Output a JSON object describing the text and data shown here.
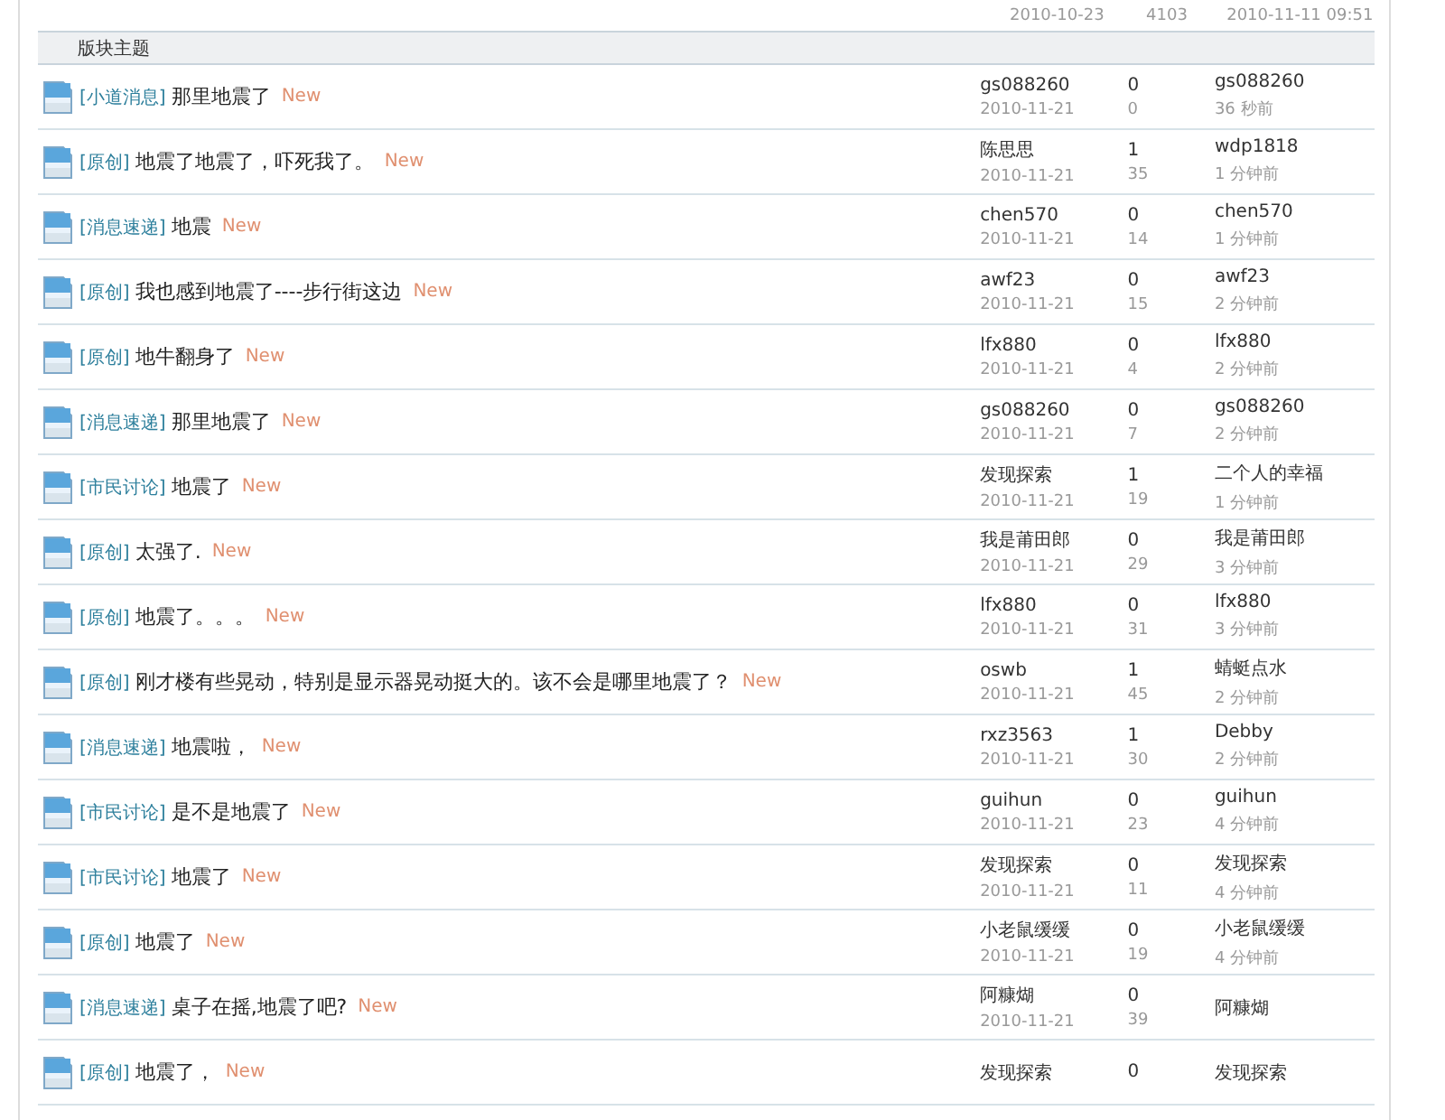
{
  "top_row": {
    "date": "2010-10-23",
    "views": "4103",
    "last_time": "2010-11-11 09:51"
  },
  "section_header": "版块主题",
  "threads": [
    {
      "tag": "[小道消息]",
      "title": "那里地震了",
      "new": "New",
      "author": "gs088260",
      "date": "2010-11-21",
      "replies": "0",
      "views": "0",
      "last_poster": "gs088260",
      "last_time": "36 秒前"
    },
    {
      "tag": "[原创]",
      "title": "地震了地震了，吓死我了。",
      "new": "New",
      "author": "陈思思",
      "date": "2010-11-21",
      "replies": "1",
      "views": "35",
      "last_poster": "wdp1818",
      "last_time": "1 分钟前"
    },
    {
      "tag": "[消息速递]",
      "title": "地震",
      "new": "New",
      "author": "chen570",
      "date": "2010-11-21",
      "replies": "0",
      "views": "14",
      "last_poster": "chen570",
      "last_time": "1 分钟前"
    },
    {
      "tag": "[原创]",
      "title": "我也感到地震了----步行街这边",
      "new": "New",
      "author": "awf23",
      "date": "2010-11-21",
      "replies": "0",
      "views": "15",
      "last_poster": "awf23",
      "last_time": "2 分钟前"
    },
    {
      "tag": "[原创]",
      "title": "地牛翻身了",
      "new": "New",
      "author": "lfx880",
      "date": "2010-11-21",
      "replies": "0",
      "views": "4",
      "last_poster": "lfx880",
      "last_time": "2 分钟前"
    },
    {
      "tag": "[消息速递]",
      "title": "那里地震了",
      "new": "New",
      "author": "gs088260",
      "date": "2010-11-21",
      "replies": "0",
      "views": "7",
      "last_poster": "gs088260",
      "last_time": "2 分钟前"
    },
    {
      "tag": "[市民讨论]",
      "title": "地震了",
      "new": "New",
      "author": "发现探索",
      "date": "2010-11-21",
      "replies": "1",
      "views": "19",
      "last_poster": "二个人的幸福",
      "last_time": "1 分钟前"
    },
    {
      "tag": "[原创]",
      "title": "太强了.",
      "new": "New",
      "author": "我是莆田郎",
      "date": "2010-11-21",
      "replies": "0",
      "views": "29",
      "last_poster": "我是莆田郎",
      "last_time": "3 分钟前"
    },
    {
      "tag": "[原创]",
      "title": "地震了。。。",
      "new": "New",
      "author": "lfx880",
      "date": "2010-11-21",
      "replies": "0",
      "views": "31",
      "last_poster": "lfx880",
      "last_time": "3 分钟前"
    },
    {
      "tag": "[原创]",
      "title": "刚才楼有些晃动，特别是显示器晃动挺大的。该不会是哪里地震了？",
      "new": "New",
      "author": "oswb",
      "date": "2010-11-21",
      "replies": "1",
      "views": "45",
      "last_poster": "蜻蜓点水",
      "last_time": "2 分钟前"
    },
    {
      "tag": "[消息速递]",
      "title": "地震啦，",
      "new": "New",
      "author": "rxz3563",
      "date": "2010-11-21",
      "replies": "1",
      "views": "30",
      "last_poster": "Debby",
      "last_time": "2 分钟前"
    },
    {
      "tag": "[市民讨论]",
      "title": "是不是地震了",
      "new": "New",
      "author": "guihun",
      "date": "2010-11-21",
      "replies": "0",
      "views": "23",
      "last_poster": "guihun",
      "last_time": "4 分钟前"
    },
    {
      "tag": "[市民讨论]",
      "title": "地震了",
      "new": "New",
      "author": "发现探索",
      "date": "2010-11-21",
      "replies": "0",
      "views": "11",
      "last_poster": "发现探索",
      "last_time": "4 分钟前"
    },
    {
      "tag": "[原创]",
      "title": "地震了",
      "new": "New",
      "author": "小老鼠缓缓",
      "date": "2010-11-21",
      "replies": "0",
      "views": "19",
      "last_poster": "小老鼠缓缓",
      "last_time": "4 分钟前"
    },
    {
      "tag": "[消息速递]",
      "title": "桌子在摇,地震了吧?",
      "new": "New",
      "author": "阿糠煳",
      "date": "2010-11-21",
      "replies": "0",
      "views": "39",
      "last_poster": "阿糠煳"
    },
    {
      "tag": "[原创]",
      "title": "地震了，",
      "new": "New",
      "author": "发现探索",
      "replies": "0",
      "last_poster": "发现探索"
    }
  ]
}
